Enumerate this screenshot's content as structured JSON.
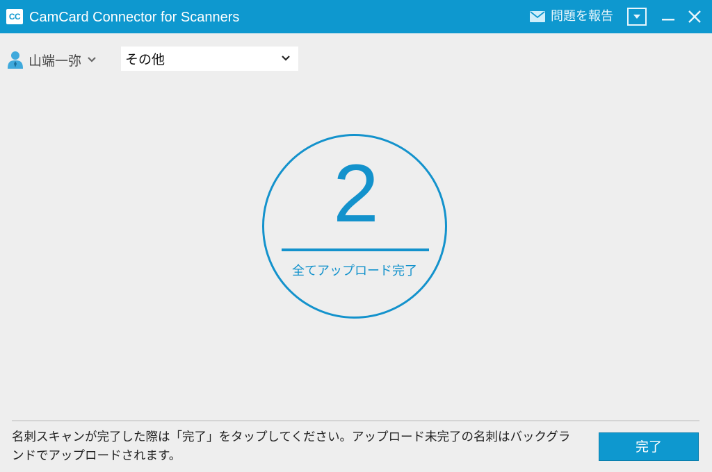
{
  "window": {
    "logo_text": "CC",
    "title": "CamCard Connector for Scanners",
    "report_label": "問題を報告",
    "icons": {
      "mail": "envelope-icon",
      "menu": "dropdown-box-icon",
      "minimize": "minimize-icon",
      "close": "close-icon"
    }
  },
  "user": {
    "name": "山端一弥",
    "icon": "person-icon"
  },
  "category": {
    "selected": "その他"
  },
  "counter": {
    "value": "2",
    "status": "全てアップロード完了"
  },
  "footer": {
    "message": "名刺スキャンが完了した際は「完了」をタップしてください。アップロード未完了の名刺はバックグランドでアップロードされます。",
    "done_label": "完了"
  },
  "colors": {
    "accent": "#0e98cf",
    "background": "#eeeeee"
  }
}
